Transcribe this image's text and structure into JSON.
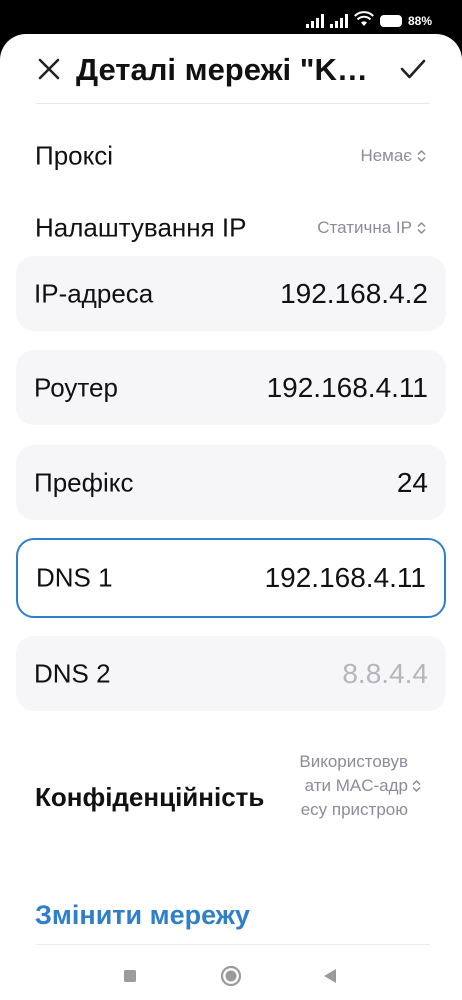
{
  "status": {
    "battery_pct": "88%"
  },
  "header": {
    "title": "Деталі мережі \"KO…"
  },
  "proxy": {
    "label": "Проксі",
    "value": "Немає"
  },
  "ip_settings": {
    "label": "Налаштування IP",
    "value": "Статична IP"
  },
  "fields": {
    "ip": {
      "label": "IP-адреса",
      "value": "192.168.4.2"
    },
    "router": {
      "label": "Роутер",
      "value": "192.168.4.11"
    },
    "prefix": {
      "label": "Префікс",
      "value": "24"
    },
    "dns1": {
      "label": "DNS 1",
      "value": "192.168.4.11"
    },
    "dns2": {
      "label": "DNS 2",
      "value": "8.8.4.4"
    }
  },
  "privacy": {
    "label": "Конфіденційність",
    "value": "Використовувати MAC-адресу пристрою"
  },
  "change_network_label": "Змінити мережу",
  "colors": {
    "accent": "#2f7fc9",
    "field_bg": "#f6f6f8",
    "secondary_text": "#8a8d98"
  },
  "icons": [
    "close-icon",
    "check-icon",
    "updown-chevron-icon",
    "wifi-icon",
    "signal-icon",
    "battery-icon",
    "nav-square-icon",
    "nav-circle-icon",
    "nav-back-icon"
  ]
}
